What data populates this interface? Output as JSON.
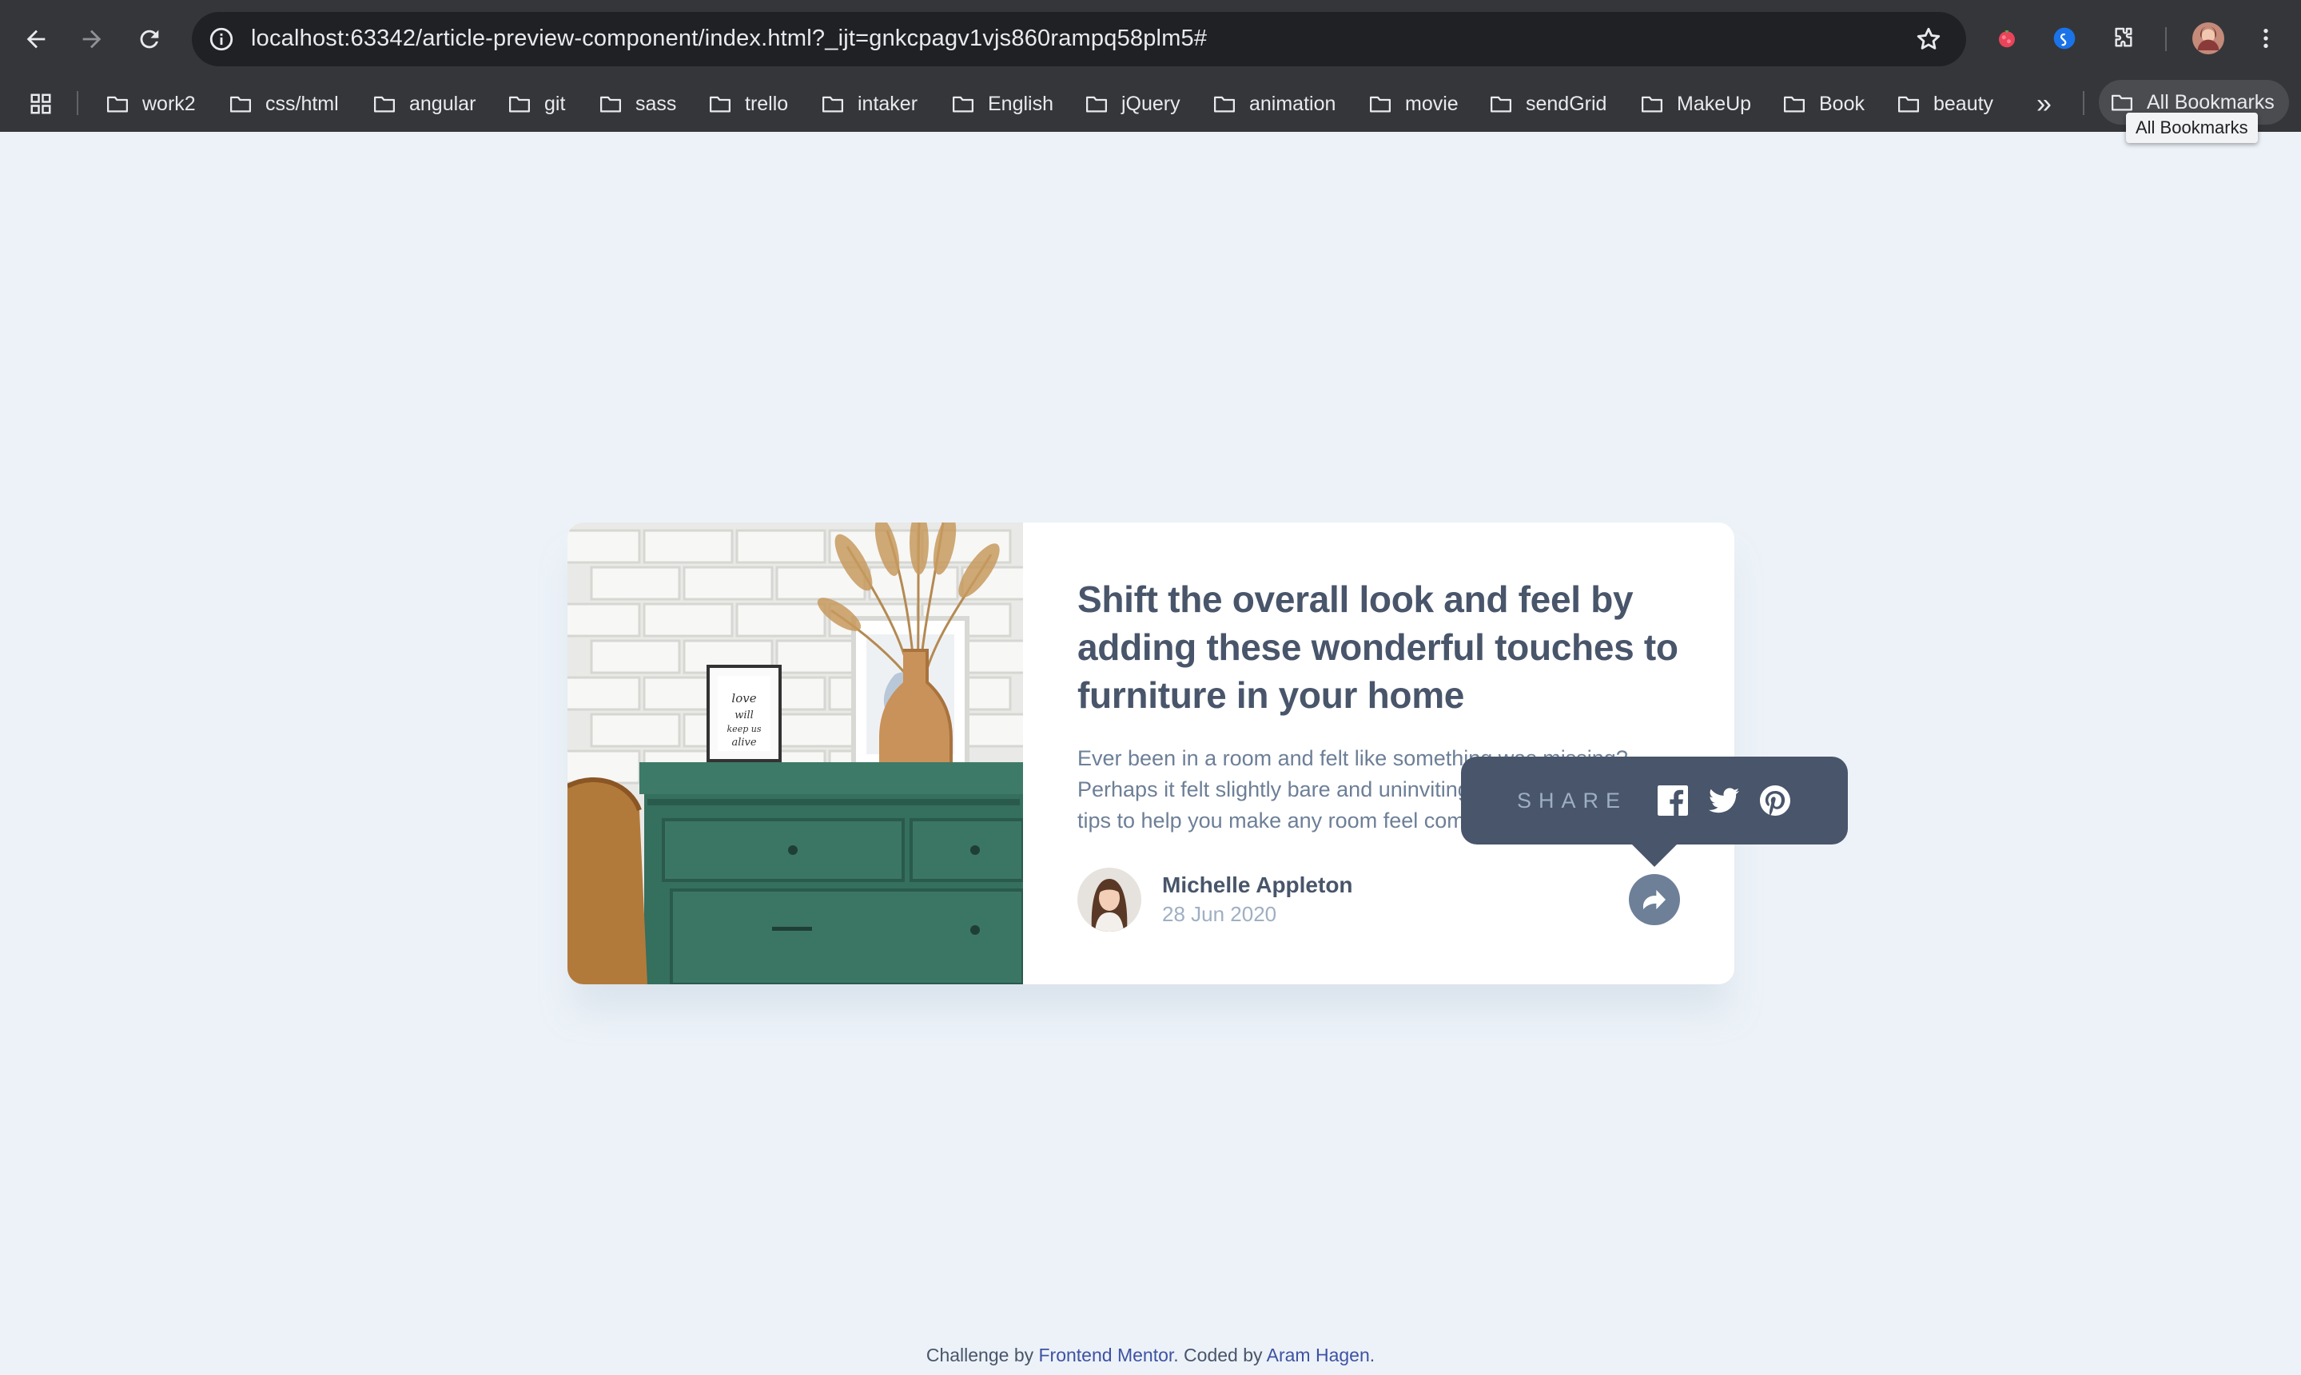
{
  "browser": {
    "url_host": "localhost",
    "url_rest": ":63342/article-preview-component/index.html?_ijt=gnkcpagv1vjs860rampq58plm5#",
    "bookmarks": [
      "work2",
      "css/html",
      "angular",
      "git",
      "sass",
      "trello",
      "intaker",
      "English",
      "jQuery",
      "animation",
      "movie",
      "sendGrid",
      "MakeUp",
      "Book",
      "beauty"
    ],
    "more_label": "»",
    "all_bookmarks_label": "All Bookmarks",
    "tooltip": "All Bookmarks"
  },
  "article": {
    "title": "Shift the overall look and feel by adding these wonderful touches to furniture in your home",
    "description": "Ever been in a room and felt like something was missing? Perhaps it felt slightly bare and uninviting. I’ve got some simple tips to help you make any room feel complete.",
    "author_name": "Michelle Appleton",
    "date": "28 Jun 2020"
  },
  "share": {
    "label": "SHARE",
    "icons": [
      "facebook-icon",
      "twitter-icon",
      "pinterest-icon"
    ]
  },
  "footer": {
    "prefix": "Challenge by",
    "fm_link": "Frontend Mentor",
    "middle": ". Coded by",
    "author_link": "Aram Hagen",
    "suffix": "."
  },
  "colors": {
    "page_bg": "#ecf2f8",
    "heading": "#48556a",
    "text": "#6d7f97",
    "muted": "#9eafc2",
    "share_popup": "#48556a",
    "share_button": "#6e8098"
  }
}
